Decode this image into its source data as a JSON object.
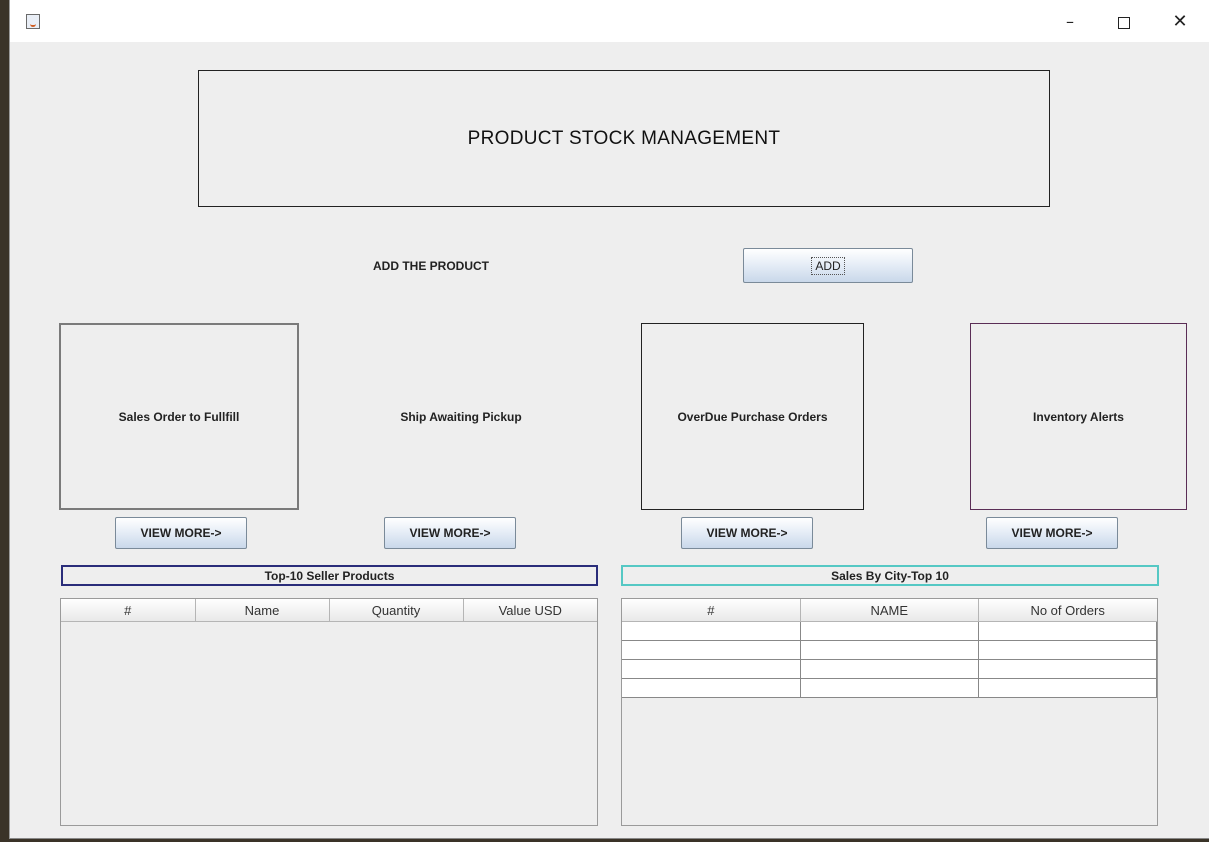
{
  "window": {
    "controls": {
      "minimize": "–",
      "maximize": "",
      "close": "✕"
    },
    "icon": "java-app-icon"
  },
  "header": {
    "title": "PRODUCT STOCK MANAGEMENT"
  },
  "add_section": {
    "label": "ADD THE PRODUCT",
    "button": "ADD"
  },
  "tiles": [
    {
      "label": "Sales Order to Fullfill",
      "button": "VIEW MORE->"
    },
    {
      "label": "Ship Awaiting Pickup",
      "button": "VIEW MORE->"
    },
    {
      "label": "OverDue Purchase Orders",
      "button": "VIEW MORE->"
    },
    {
      "label": "Inventory Alerts",
      "button": "VIEW MORE->"
    }
  ],
  "top_sellers": {
    "title": "Top-10 Seller Products",
    "columns": [
      "#",
      "Name",
      "Quantity",
      "Value USD"
    ],
    "rows": []
  },
  "sales_by_city": {
    "title": "Sales By City-Top 10",
    "columns": [
      "#",
      "NAME",
      "No of Orders"
    ],
    "rows": [
      [
        "",
        "",
        ""
      ],
      [
        "",
        "",
        ""
      ],
      [
        "",
        "",
        ""
      ],
      [
        "",
        "",
        ""
      ]
    ]
  }
}
